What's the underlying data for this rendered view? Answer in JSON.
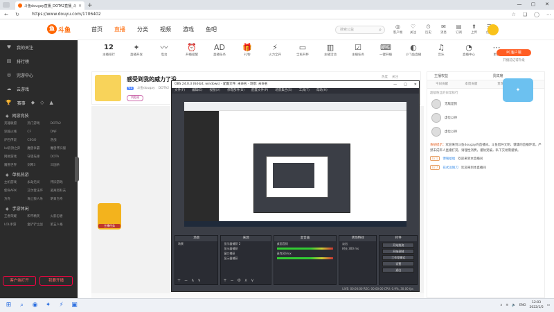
{
  "browser": {
    "tab_title": "斗鱼dougay直播_DOTA2直播_斗鱼直播",
    "tab_close": "×",
    "new_tab": "+",
    "url": "https://www.douyu.com/1706402",
    "win_min": "—",
    "win_max": "▢",
    "win_close": "✕"
  },
  "header": {
    "logo_text": "斗鱼",
    "nav": [
      "首页",
      "直播",
      "分类",
      "视频",
      "游戏",
      "鱼吧"
    ],
    "search_placeholder": "搜索公益",
    "icons": [
      {
        "glyph": "◎",
        "label": "客户端"
      },
      {
        "glyph": "♡",
        "label": "关注"
      },
      {
        "glyph": "⏲",
        "label": "历史"
      },
      {
        "glyph": "✉",
        "label": "消息"
      },
      {
        "glyph": "▤",
        "label": "订阅"
      },
      {
        "glyph": "⬆",
        "label": "上传"
      },
      {
        "glyph": "☰",
        "label": "创作"
      }
    ]
  },
  "sidebar": {
    "items": [
      {
        "icon": "♥",
        "label": "我的关注"
      },
      {
        "icon": "▤",
        "label": "排行榜"
      },
      {
        "icon": "◎",
        "label": "完游中心"
      },
      {
        "icon": "☁",
        "label": "云游戏"
      }
    ],
    "event_row": {
      "icon": "🏆",
      "label": "赛事"
    },
    "sections": [
      {
        "title": "网游竞技",
        "games": [
          "英雄联盟",
          "热门游戏",
          "DOTA2",
          "穿越火线",
          "CF",
          "DNF",
          "炉石传说",
          "CSGO",
          "逆战",
          "lol云顶之弈",
          "魔兽争霸",
          "魔兽怀旧服",
          "网易游戏",
          "守望先锋",
          "DOTA",
          "魔兽世界",
          "剑网3",
          "三国杀"
        ]
      },
      {
        "title": "单机热游",
        "games": [
          "主机游戏",
          "永劫无间",
          "怀旧游戏",
          "使命ARK",
          "艾尔登法环",
          "逃离塔科夫",
          "方舟",
          "海上狼人杀",
          "明日方舟"
        ]
      },
      {
        "title": "手游休闲",
        "games": [
          "王者荣耀",
          "和平精英",
          "火影忍者",
          "LOL手游",
          "金铲铲之战",
          "第五人格"
        ]
      }
    ],
    "btn_open": "客户端打开",
    "btn_room": "我要开播"
  },
  "categories": {
    "count": "12",
    "count_label": "主播排行",
    "items": [
      {
        "glyph": "✦",
        "label": "直播开发"
      },
      {
        "glyph": "〰",
        "label": "电台"
      },
      {
        "glyph": "⏰",
        "label": "开播提醒"
      },
      {
        "glyph": "AD",
        "label": "直播任务"
      },
      {
        "glyph": "🎁",
        "label": "礼物"
      },
      {
        "glyph": "⚡",
        "label": "火力全开"
      },
      {
        "glyph": "▭",
        "label": "全民开杯"
      },
      {
        "glyph": "▥",
        "label": "主播活动"
      },
      {
        "glyph": "☑",
        "label": "主播任务"
      },
      {
        "glyph": "⌨",
        "label": "一键开播"
      },
      {
        "glyph": "◐",
        "label": "小飞鱼直播"
      },
      {
        "glyph": "♫",
        "label": "音乐"
      },
      {
        "glyph": "◔",
        "label": "直播中心"
      },
      {
        "glyph": "⋯",
        "label": "更多"
      }
    ],
    "pc_btn": "PC客户端",
    "pc_sub": "开播前记得升级"
  },
  "room": {
    "title": "感受到我的威力了没",
    "owner": "斗鱼dougay",
    "badge": "V1",
    "meta": "DOTA2 · 全部精彩",
    "btn_v": "V房间",
    "btn_follow": "直播提醒",
    "right_stats": [
      "热度",
      "关注"
    ]
  },
  "obs": {
    "title": "OBS 24.0.3 (64-bit, windows) - 配置文件: 未命名 - 场景: 未命名",
    "menu": [
      "文件(F)",
      "编辑(E)",
      "视图(V)",
      "停靠部件(D)",
      "配置文件(P)",
      "场景集合(S)",
      "工具(T)",
      "帮助(H)"
    ],
    "docks": {
      "scenes": {
        "title": "场景",
        "rows": [
          "场景"
        ]
      },
      "sources": {
        "title": "来源",
        "rows": [
          "显示器捕获 2",
          "显示器捕获",
          "窗口捕获",
          "显示器捕获"
        ]
      },
      "mixer": {
        "title": "混音器",
        "rows": [
          "桌面音频",
          "麦克风/Aux"
        ]
      },
      "transitions": {
        "title": "转场特效",
        "rows": [
          "淡出",
          "时长 300 ms"
        ]
      },
      "controls": {
        "title": "控件",
        "buttons": [
          "开始推流",
          "开始录制",
          "工作室模式",
          "设置",
          "退出"
        ]
      }
    },
    "status": "LIVE: 00:00:00    REC: 00:00:00    CPU: 0.9%, 30.00 fps"
  },
  "chat": {
    "tabs1": [
      "主播权益",
      "贵宾席"
    ],
    "tabs2": [
      "今日贡献",
      "本周贡献",
      "贵宾",
      "粉丝"
    ],
    "note": "超级粉丝的日常排行",
    "ranks": [
      "无敌是我",
      "虚位以待",
      "虚位以待"
    ],
    "sys_tag": "系统提示：",
    "sys_msg": "欢迎来到斗鱼dougay的直播间。斗鱼倡导文明、健康的直播环境，严禁未成年人直播打赏，请理性消费，谨防受骗，私下交易需谨慎。",
    "messages": [
      {
        "level": "LV 1",
        "user": "傅铭蛤蛤",
        "text": "欢迎来到本直播间"
      },
      {
        "level": "LV 7",
        "user": "花式逗鲜刀",
        "text": "欢迎来到本直播间"
      }
    ],
    "mascot_text": "主播任务"
  },
  "taskbar": {
    "icons": [
      "⊞",
      "⌕",
      "◉",
      "✦",
      "⚡",
      "▣"
    ],
    "tray": [
      "∧",
      "ENG"
    ],
    "time": "12:03",
    "date": "2022/1/5"
  }
}
